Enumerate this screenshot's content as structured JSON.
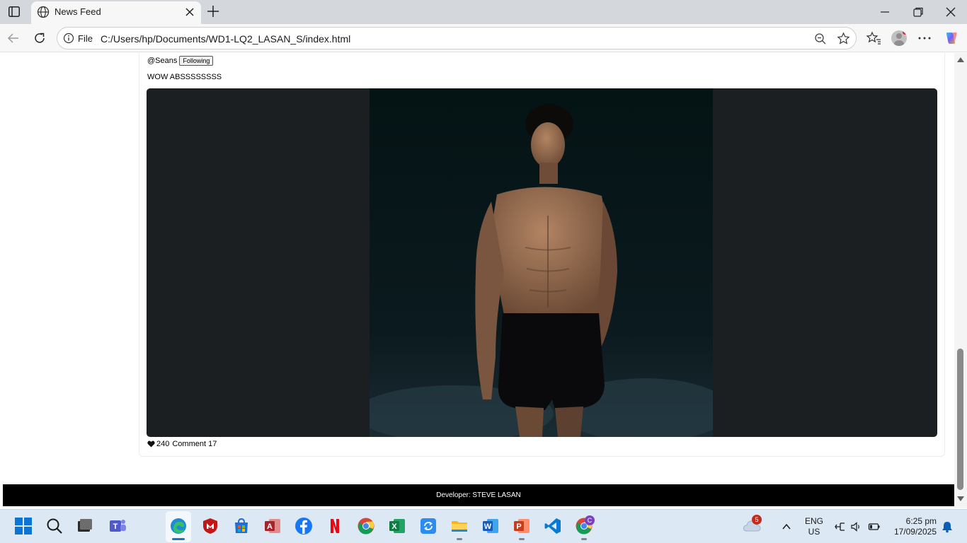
{
  "browser": {
    "tab_title": "News Feed",
    "address_scheme_label": "File",
    "url": "C:/Users/hp/Documents/WD1-LQ2_LASAN_S/index.html"
  },
  "post": {
    "handle": "@Seans",
    "follow_label": "Following",
    "text": "WOW ABSSSSSSSS",
    "likes": "240",
    "comment_label": "Comment 17",
    "image_alt": "photo"
  },
  "footer": {
    "text": "Developer: STEVE LASAN"
  },
  "taskbar": {
    "weather_badge": "5",
    "chrome_badge": "C",
    "lang_line1": "ENG",
    "lang_line2": "US",
    "time": "6:25 pm",
    "date": "17/09/2025"
  },
  "colors": {
    "accent": "#1a73d0",
    "media_bg": "#1b1f21",
    "footer_bg": "#000000"
  }
}
